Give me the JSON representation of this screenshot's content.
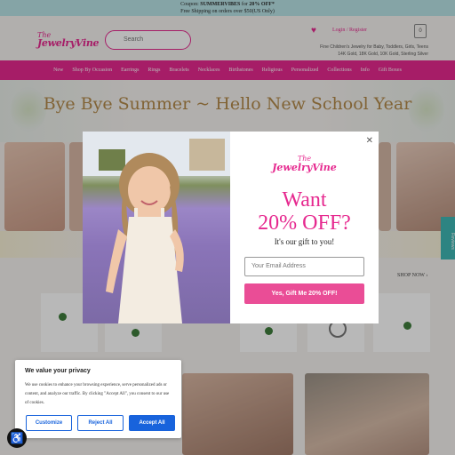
{
  "announcement": {
    "prefix": "Coupon: ",
    "code": "SUMMERVIBES",
    "mid": " for ",
    "discount": "20% OFF*",
    "line2": "Free Shipping on orders over $50(US Only)"
  },
  "header": {
    "logo_the": "The",
    "logo_brand": "JewelryVine",
    "search_placeholder": "Search",
    "login": "Login / Register",
    "cart_count": "0",
    "tagline_1": "Fine Children's Jewelry for Baby, Toddlers, Girls, Teens",
    "tagline_2": "14K Gold, 18K Gold, 10K Gold, Sterling Silver"
  },
  "nav": [
    "New",
    "Shop By Occasion",
    "Earrings",
    "Rings",
    "Bracelets",
    "Necklaces",
    "Birthstones",
    "Religious",
    "Personalized",
    "Collections",
    "Info",
    "Gift Boxes"
  ],
  "hero": {
    "title": "Bye Bye Summer ~ Hello New School Year"
  },
  "shop_now": "SHOP NOW  ›",
  "side_tab": "Reviews",
  "popup": {
    "logo_the": "The",
    "logo_brand": "JewelryVine",
    "headline_1": "Want",
    "headline_2": "20% OFF?",
    "subtext": "It's our gift to you!",
    "email_placeholder": "Your Email Address",
    "cta": "Yes, Gift Me 20% OFF!"
  },
  "cookie": {
    "title": "We value your privacy",
    "text": "We use cookies to enhance your browsing experience, serve personalized ads or content, and analyze our traffic. By clicking \"Accept All\", you consent to our use of cookies.",
    "customize": "Customize",
    "reject": "Reject All",
    "accept": "Accept All"
  },
  "colors": {
    "brand_pink": "#e6298f",
    "teal": "#b9e4e6",
    "accent_blue": "#1863dc",
    "hero_gold": "#b38a4a"
  }
}
